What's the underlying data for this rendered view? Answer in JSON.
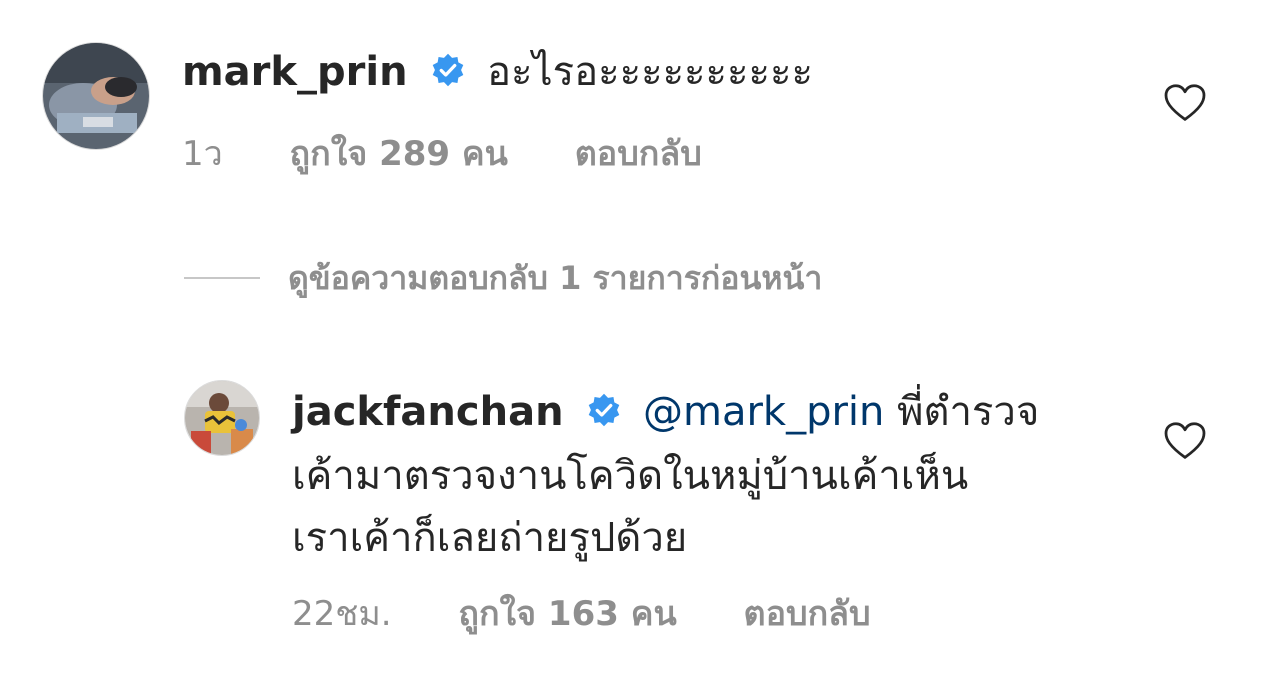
{
  "comments": [
    {
      "username": "mark_prin",
      "text": "อะไรอะะะะะะะะะะ",
      "time": "1ว",
      "likes": "ถูกใจ 289 คน",
      "reply_label": "ตอบกลับ"
    },
    {
      "username": "jackfanchan",
      "mention": "@mark_prin",
      "text_line1": "พี่ตำรวจ",
      "text_line2": "เค้ามาตรวจงานโควิดในหมู่บ้านเค้าเห็น",
      "text_line3": "เราเค้าก็เลยถ่ายรูปด้วย",
      "time": "22ชม.",
      "likes": "ถูกใจ 163 คน",
      "reply_label": "ตอบกลับ"
    }
  ],
  "view_replies": "ดูข้อความตอบกลับ 1 รายการก่อนหน้า",
  "icons": {
    "verified": "verified-badge-icon",
    "like": "heart-outline-icon"
  },
  "colors": {
    "verified_blue": "#3897f0",
    "mention": "#00376b",
    "meta_gray": "#8e8e8e"
  }
}
